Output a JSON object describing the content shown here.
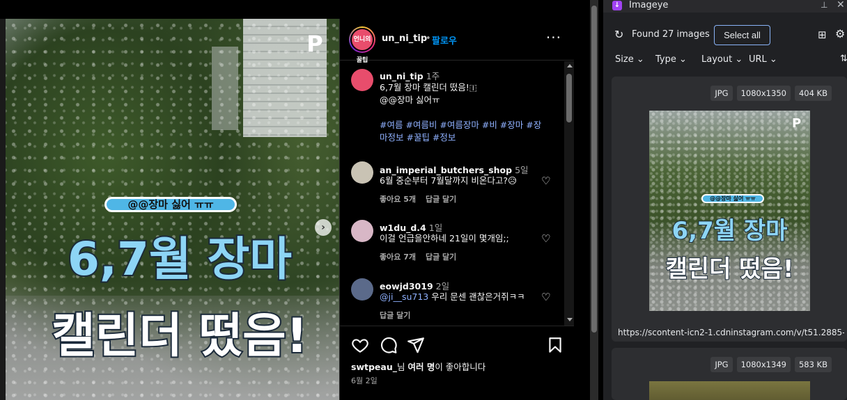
{
  "post": {
    "logo_glyph": "P",
    "caption_pill": "@@장마 싫어 ㅠㅠ",
    "title_line1": "6,7월 장마",
    "title_line2": "캘린더 떴음!",
    "next_glyph": "›"
  },
  "header": {
    "avatar_text": "언니의 꿀팁",
    "username": "un_ni_tip",
    "dot": "•",
    "follow": "팔로우",
    "more": "···"
  },
  "comments": [
    {
      "user": "un_ni_tip",
      "time": "1주",
      "line1": "6,7월 장마 캘린더 떴음!🇮",
      "line2": "@@장마 싫어ㅠ",
      "hashtags_line1": "#여름 #여름비 #여름장마 #비 #장마 #장",
      "hashtags_line2": "마정보 #꿀팁 #정보"
    },
    {
      "user": "an_imperial_butchers_shop",
      "time": "5일",
      "text": "6월 중순부터 7월달까지 비온다고?😥",
      "likes": "좋아요 5개",
      "reply": "답글 달기"
    },
    {
      "user": "w1du_d.4",
      "time": "1일",
      "text": "이걸 언급을안하네 21일이 몇개임;;",
      "likes": "좋아요 7개",
      "reply": "답글 달기"
    },
    {
      "user": "eowjd3019",
      "time": "2일",
      "mention": "@ji__su713",
      "text": " 우리 문센 괜찮은거쥐ㅋㅋ",
      "reply": "답글 달기"
    }
  ],
  "actions": {
    "likes_user": "swtpeau_",
    "likes_suffix1": "님 ",
    "likes_bold": "여러 명",
    "likes_suffix2": "이 좋아합니다",
    "date": "6월 2일"
  },
  "extension": {
    "name": "Imageye",
    "found": "Found 27 images",
    "select_all": "Select all",
    "filters": [
      "Size",
      "Type",
      "Layout",
      "URL"
    ],
    "cards": [
      {
        "format": "JPG",
        "dims": "1080x1350",
        "size": "404 KB",
        "url": "https://scontent-icn2-1.cdninstagram.com/v/t51.2885-1"
      },
      {
        "format": "JPG",
        "dims": "1080x1349",
        "size": "583 KB"
      }
    ]
  },
  "colors": {
    "follow_blue": "#0095f6",
    "hashtag": "#8fb1ff",
    "select_border": "#8ab4f8"
  }
}
